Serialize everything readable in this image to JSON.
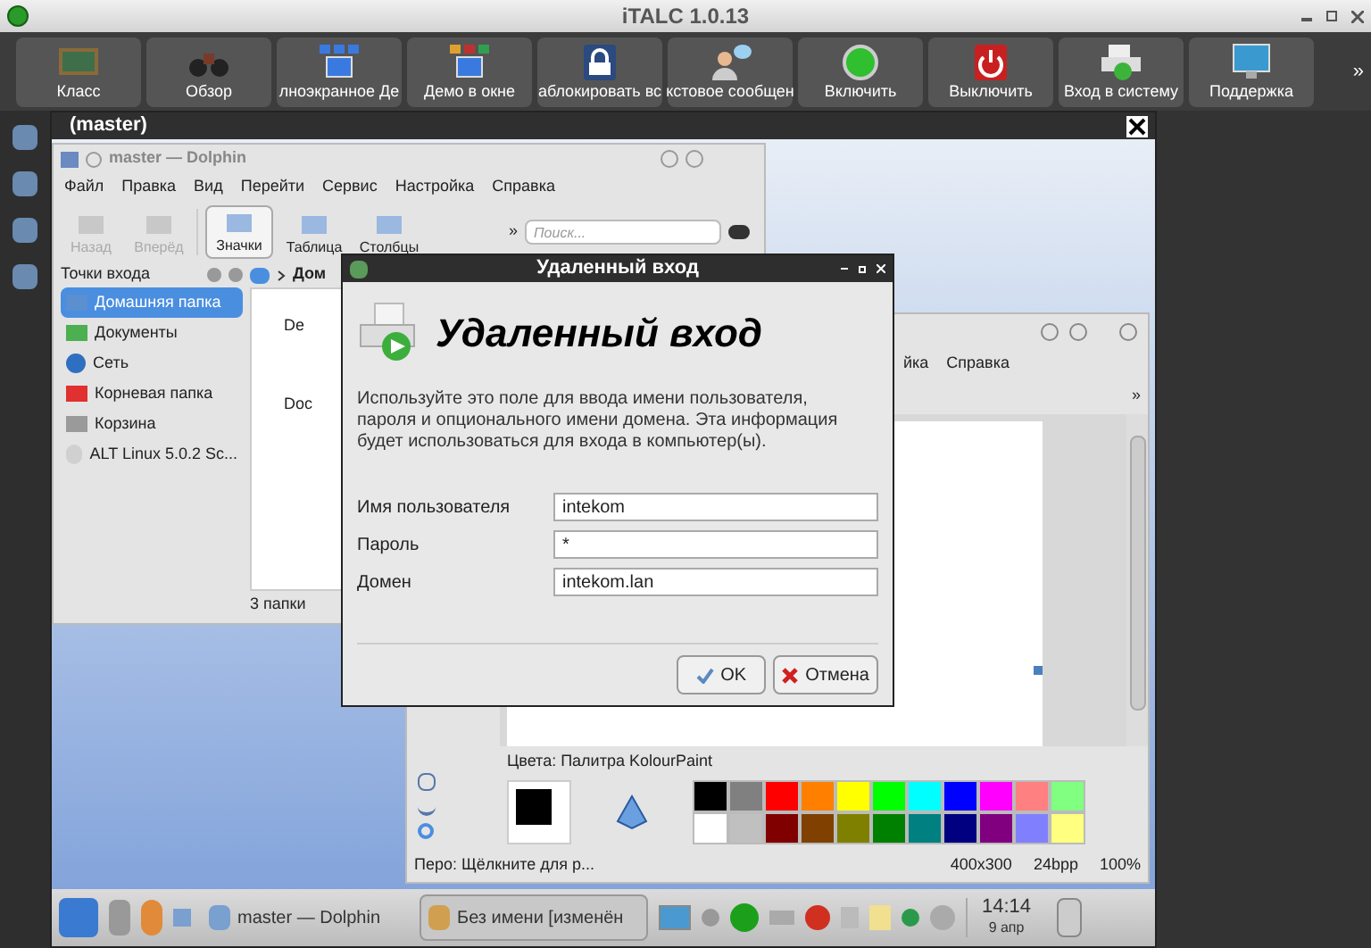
{
  "window": {
    "title": "iTALC 1.0.13"
  },
  "toolbar": {
    "buttons": [
      {
        "label": "Класс"
      },
      {
        "label": "Обзор"
      },
      {
        "label": "лноэкранное Де"
      },
      {
        "label": "Демо в окне"
      },
      {
        "label": "аблокировать вс"
      },
      {
        "label": "кстовое сообщен"
      },
      {
        "label": "Включить"
      },
      {
        "label": "Выключить"
      },
      {
        "label": "Вход в систему"
      },
      {
        "label": "Поддержка"
      }
    ],
    "overflow": "»"
  },
  "remote_view": {
    "title": "(master)"
  },
  "dolphin": {
    "title": "master — Dolphin",
    "menu": [
      "Файл",
      "Правка",
      "Вид",
      "Перейти",
      "Сервис",
      "Настройка",
      "Справка"
    ],
    "nav": [
      {
        "label": "Назад",
        "disabled": true
      },
      {
        "label": "Вперёд",
        "disabled": true
      }
    ],
    "views": [
      {
        "label": "Значки",
        "selected": true
      },
      {
        "label": "Таблица",
        "selected": false
      },
      {
        "label": "Столбцы",
        "selected": false
      }
    ],
    "overflow": "»",
    "search": {
      "placeholder": "Поиск..."
    },
    "places_title": "Точки входа",
    "places": [
      {
        "label": "Домашняя папка",
        "selected": true,
        "color": "#5a8fd0"
      },
      {
        "label": "Документы",
        "selected": false,
        "color": "#4caf50"
      },
      {
        "label": "Сеть",
        "selected": false,
        "color": "#2f6fc0"
      },
      {
        "label": "Корневая папка",
        "selected": false,
        "color": "#e03030"
      },
      {
        "label": "Корзина",
        "selected": false,
        "color": "#9a9a9a"
      },
      {
        "label": "ALT Linux 5.0.2 Sc...",
        "selected": false,
        "color": "#d0d0d0"
      }
    ],
    "breadcrumb": "Дом",
    "files": [
      "De",
      "Doc"
    ],
    "status": "3 папки"
  },
  "paint": {
    "menu": [
      "йка",
      "Справка"
    ],
    "overflow": "»",
    "colors_label": "Цвета: Палитра KolourPaint",
    "palette_top": [
      {
        "color": "#000000"
      },
      {
        "color": "#808080"
      },
      {
        "color": "#ff0000"
      },
      {
        "color": "#ff8000"
      },
      {
        "color": "#ffff00"
      },
      {
        "color": "#00ff00"
      },
      {
        "color": "#00ffff"
      },
      {
        "color": "#0000ff"
      },
      {
        "color": "#ff00ff"
      },
      {
        "color": "#ff8080"
      },
      {
        "color": "#80ff80"
      }
    ],
    "palette_bottom": [
      {
        "color": "#ffffff"
      },
      {
        "color": "#c0c0c0"
      },
      {
        "color": "#800000"
      },
      {
        "color": "#804000"
      },
      {
        "color": "#808000"
      },
      {
        "color": "#008000"
      },
      {
        "color": "#008080"
      },
      {
        "color": "#000080"
      },
      {
        "color": "#800080"
      },
      {
        "color": "#8080ff"
      },
      {
        "color": "#ffff80"
      }
    ],
    "status": "Перо: Щёлкните для р...",
    "size": "400x300",
    "depth": "24bpp",
    "zoom": "100%"
  },
  "dialog": {
    "title": "Удаленный вход",
    "heading": "Удаленный вход",
    "description": "Используйте это поле для ввода имени пользователя, пароля и опционального имени домена. Эта информация будет использоваться для входа в компьютер(ы).",
    "fields": [
      {
        "label": "Имя пользователя",
        "value": "intekom"
      },
      {
        "label": "Пароль",
        "value": "*"
      },
      {
        "label": "Домен",
        "value": "intekom.lan"
      }
    ],
    "ok": "OK",
    "cancel": "Отмена"
  },
  "taskbar": {
    "tasks": [
      {
        "label": "master — Dolphin",
        "selected": false
      },
      {
        "label": "Без имени [изменён",
        "selected": true
      }
    ],
    "time": "14:14",
    "date": "9 апр"
  }
}
